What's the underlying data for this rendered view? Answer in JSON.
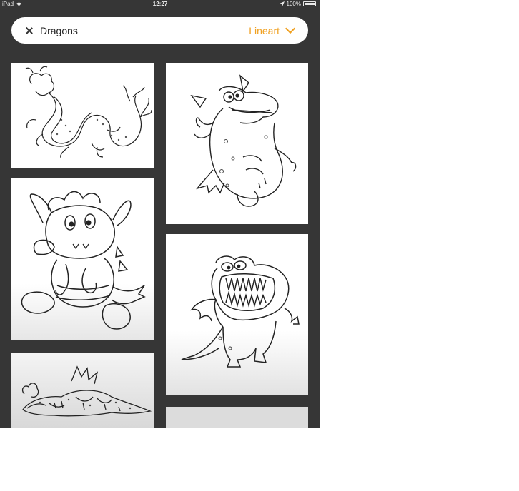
{
  "status_bar": {
    "carrier": "iPad",
    "time": "12:27",
    "battery": "100%"
  },
  "search": {
    "query": "Dragons",
    "filter_label": "Lineart"
  },
  "icons": {
    "close": "close-icon",
    "filter": "chevron-down-icon",
    "wifi": "wifi-icon",
    "location": "location-arrow-icon",
    "battery": "battery-icon"
  },
  "colors": {
    "accent": "#f0a020",
    "background": "#363636",
    "card": "#ffffff"
  },
  "results": [
    {
      "subject": "chinese-dragon"
    },
    {
      "subject": "cartoon-dragon-waving"
    },
    {
      "subject": "baby-dragon-sitting"
    },
    {
      "subject": "toothy-monster-dragon"
    },
    {
      "subject": "sleeping-dragon"
    },
    {
      "subject": "dragon-partial"
    }
  ]
}
